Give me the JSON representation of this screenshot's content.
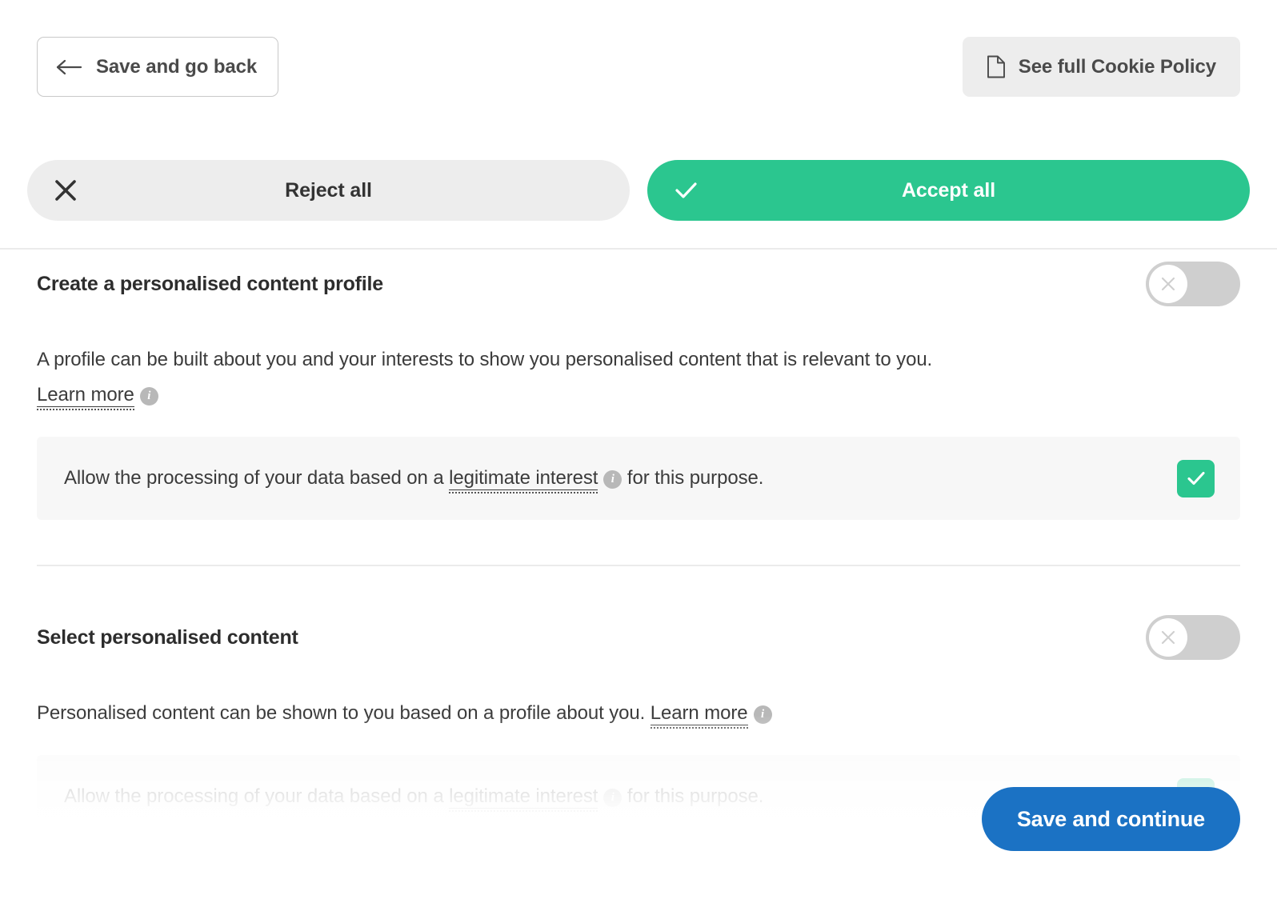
{
  "header": {
    "back_button": {
      "label": "Save and go back",
      "icon": "arrow-left-icon"
    },
    "policy_button": {
      "label": "See full Cookie Policy",
      "icon": "document-icon"
    },
    "reject_button": {
      "label": "Reject all",
      "icon": "close-x-icon"
    },
    "accept_button": {
      "label": "Accept all",
      "icon": "check-icon"
    }
  },
  "colors": {
    "accept_green": "#2bc68f",
    "save_blue": "#1b72c4",
    "neutral_grey": "#ededed",
    "toggle_off_grey": "#cfcfcf",
    "row_background": "#f7f7f7",
    "divider": "#ebebeb",
    "text_dark": "#3b3b3b"
  },
  "purposes": [
    {
      "title": "Create a personalised content profile",
      "toggle_state": "off",
      "toggle_icon": "close-x-icon",
      "description": "A profile can be built about you and your interests to show you personalised content that is relevant to you.",
      "learn_more_label": "Learn more",
      "info_badge": "i",
      "legitimate_interest": {
        "text_before": "Allow the processing of your data based on a ",
        "link_label": "legitimate interest",
        "info_badge": "i",
        "text_after": " for this purpose.",
        "checkbox_state": "checked",
        "checkbox_icon": "check-icon"
      }
    },
    {
      "title": "Select personalised content",
      "toggle_state": "off",
      "toggle_icon": "close-x-icon",
      "description": "Personalised content can be shown to you based on a profile about you.",
      "learn_more_label": "Learn more",
      "info_badge": "i",
      "legitimate_interest": {
        "text_before": "Allow the processing of your data based on a ",
        "link_label": "legitimate interest",
        "info_badge": "i",
        "text_after": " for this purpose.",
        "checkbox_state": "checked",
        "checkbox_icon": "check-icon"
      }
    }
  ],
  "footer": {
    "save_continue_label": "Save and continue"
  }
}
